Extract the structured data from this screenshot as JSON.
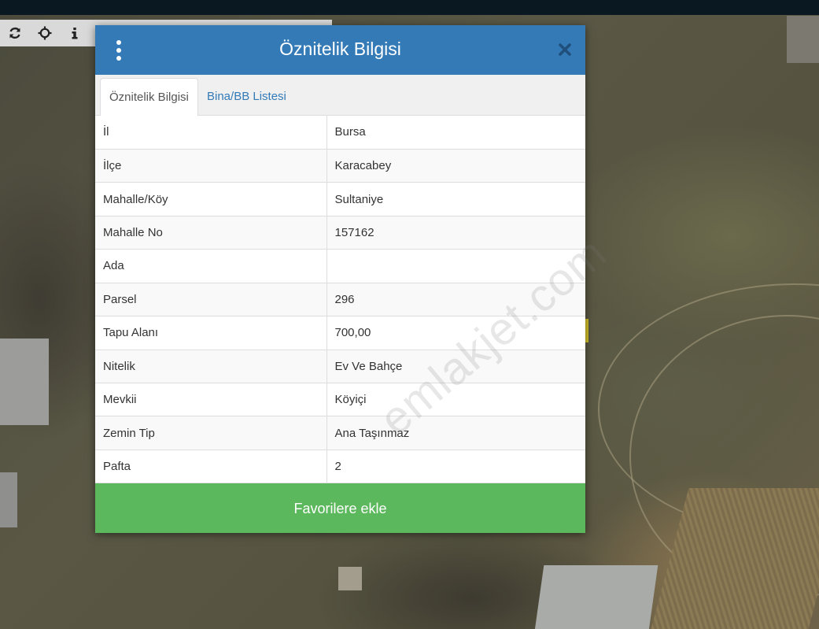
{
  "toolbar": {
    "icons": [
      "refresh-icon",
      "crosshair-icon",
      "info-icon"
    ]
  },
  "modal": {
    "title": "Öznitelik Bilgisi",
    "tabs": [
      {
        "label": "Öznitelik Bilgisi",
        "active": true
      },
      {
        "label": "Bina/BB Listesi",
        "active": false
      }
    ],
    "rows": [
      {
        "key": "İl",
        "value": "Bursa"
      },
      {
        "key": "İlçe",
        "value": "Karacabey"
      },
      {
        "key": "Mahalle/Köy",
        "value": "Sultaniye"
      },
      {
        "key": "Mahalle No",
        "value": "157162"
      },
      {
        "key": "Ada",
        "value": ""
      },
      {
        "key": "Parsel",
        "value": "296"
      },
      {
        "key": "Tapu Alanı",
        "value": "700,00"
      },
      {
        "key": "Nitelik",
        "value": "Ev Ve Bahçe"
      },
      {
        "key": "Mevkii",
        "value": "Köyiçi"
      },
      {
        "key": "Zemin Tip",
        "value": "Ana Taşınmaz"
      },
      {
        "key": "Pafta",
        "value": "2"
      }
    ],
    "favorite_button_label": "Favorilere ekle"
  },
  "watermark": "emlakjet.com",
  "colors": {
    "header": "#337ab7",
    "favorite_button": "#5cb85c",
    "tab_link": "#337ab7"
  }
}
